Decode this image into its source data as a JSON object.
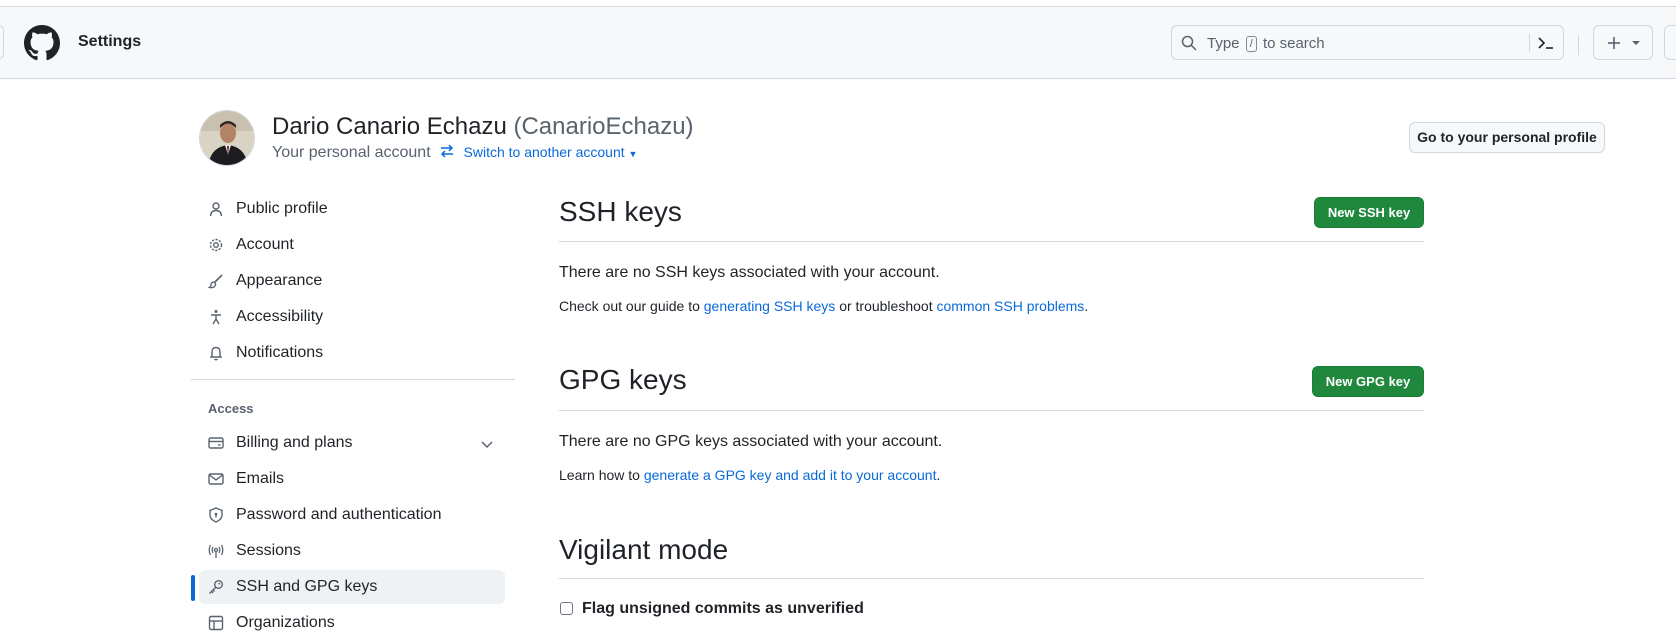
{
  "header": {
    "context_title": "Settings",
    "search": {
      "placeholder_before": "Type",
      "placeholder_key": "/",
      "placeholder_after": "to search"
    }
  },
  "account": {
    "name": "Dario Canario Echazu",
    "login": "(CanarioEchazu)",
    "subtitle": "Your personal account",
    "switch_label": "Switch to another account",
    "profile_button": "Go to your personal profile"
  },
  "sidebar": {
    "items_top": [
      {
        "label": "Public profile",
        "icon": "person-icon"
      },
      {
        "label": "Account",
        "icon": "gear-icon"
      },
      {
        "label": "Appearance",
        "icon": "paintbrush-icon"
      },
      {
        "label": "Accessibility",
        "icon": "accessibility-icon"
      },
      {
        "label": "Notifications",
        "icon": "bell-icon"
      }
    ],
    "access_heading": "Access",
    "items_access": [
      {
        "label": "Billing and plans",
        "icon": "credit-card-icon"
      },
      {
        "label": "Emails",
        "icon": "mail-icon"
      },
      {
        "label": "Password and authentication",
        "icon": "shield-lock-icon"
      },
      {
        "label": "Sessions",
        "icon": "broadcast-icon"
      },
      {
        "label": "SSH and GPG keys",
        "icon": "key-icon",
        "active": true
      },
      {
        "label": "Organizations",
        "icon": "table-icon"
      }
    ]
  },
  "main": {
    "ssh": {
      "title": "SSH keys",
      "button": "New SSH key",
      "empty": "There are no SSH keys associated with your account.",
      "guide_prefix": "Check out our guide to",
      "guide_link": "generating SSH keys",
      "guide_middle": "or troubleshoot",
      "guide_link2": "common SSH problems",
      "guide_suffix": "."
    },
    "gpg": {
      "title": "GPG keys",
      "button": "New GPG key",
      "empty": "There are no GPG keys associated with your account.",
      "learn_prefix": "Learn how to",
      "learn_link": "generate a GPG key and add it to your account",
      "learn_suffix": "."
    },
    "vigilant": {
      "title": "Vigilant mode",
      "checkbox_label": "Flag unsigned commits as unverified"
    }
  },
  "colors": {
    "accent": "#0969da",
    "primary_button": "#1f883d",
    "header_bg": "#f6f8fa"
  }
}
